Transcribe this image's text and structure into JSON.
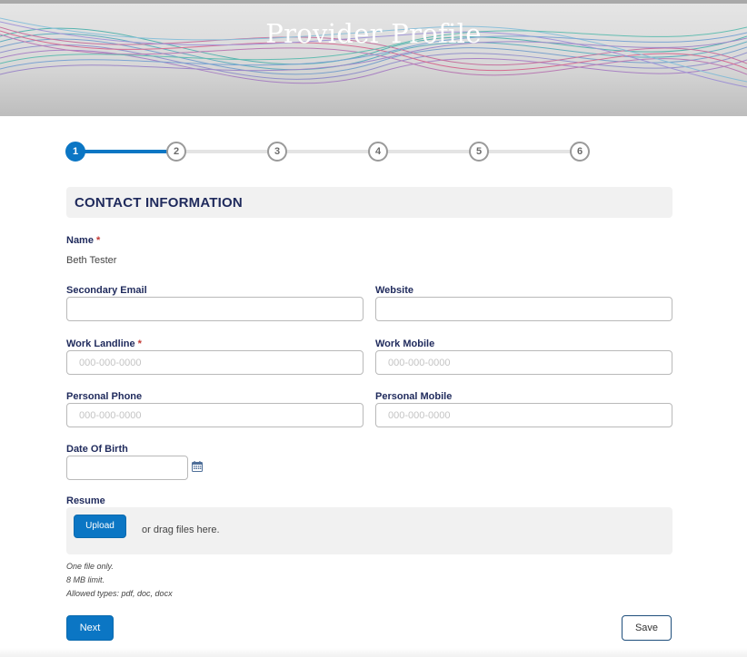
{
  "header": {
    "title": "Provider Profile"
  },
  "stepper": {
    "steps": [
      "1",
      "2",
      "3",
      "4",
      "5",
      "6"
    ],
    "active_step": 1
  },
  "section": {
    "title": "CONTACT INFORMATION"
  },
  "fields": {
    "name": {
      "label": "Name",
      "required_mark": "*",
      "value": "Beth Tester"
    },
    "secondary_email": {
      "label": "Secondary Email",
      "value": "",
      "placeholder": ""
    },
    "website": {
      "label": "Website",
      "value": "",
      "placeholder": ""
    },
    "work_landline": {
      "label": "Work Landline",
      "required_mark": "*",
      "value": "",
      "placeholder": "000-000-0000"
    },
    "work_mobile": {
      "label": "Work Mobile",
      "value": "",
      "placeholder": "000-000-0000"
    },
    "personal_phone": {
      "label": "Personal Phone",
      "value": "",
      "placeholder": "000-000-0000"
    },
    "personal_mobile": {
      "label": "Personal Mobile",
      "value": "",
      "placeholder": "000-000-0000"
    },
    "date_of_birth": {
      "label": "Date Of Birth",
      "value": "",
      "placeholder": "",
      "icon": "calendar-icon"
    }
  },
  "resume": {
    "label": "Resume",
    "upload_label": "Upload",
    "drop_text": "or drag files here.",
    "hints": [
      "One file only.",
      "8 MB limit.",
      "Allowed types: pdf, doc, docx"
    ]
  },
  "actions": {
    "next_label": "Next",
    "save_label": "Save"
  },
  "colors": {
    "primary": "#0b76c4",
    "label": "#1f2a5c",
    "required": "#c23934",
    "section_bg": "#f1f1f1"
  }
}
